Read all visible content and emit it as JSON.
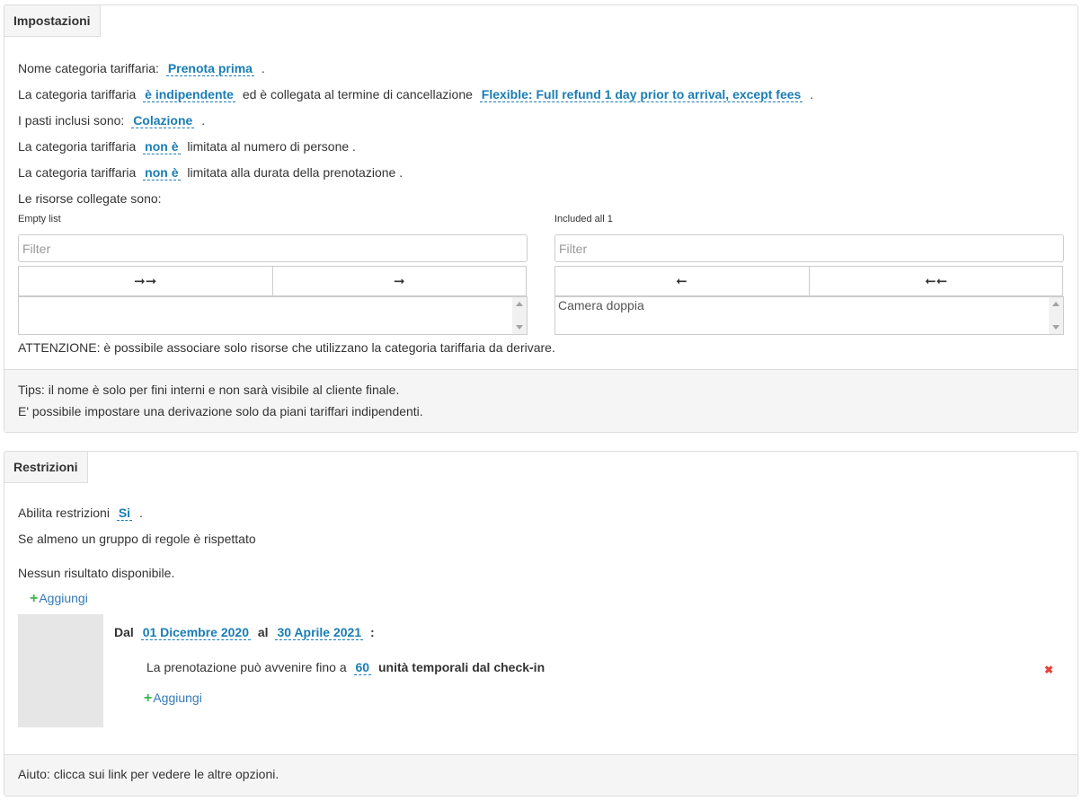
{
  "settings": {
    "tab_label": "Impostazioni",
    "line1": {
      "prefix": "Nome categoria tariffaria:",
      "link": "Prenota prima",
      "suffix": "."
    },
    "line2": {
      "prefix": "La categoria tariffaria",
      "link1": "è indipendente",
      "middle": "ed è collegata al termine di cancellazione",
      "link2": "Flexible: Full refund 1 day prior to arrival, except fees",
      "suffix": "."
    },
    "line3": {
      "prefix": "I pasti inclusi sono:",
      "link": "Colazione",
      "suffix": "."
    },
    "line4": {
      "prefix": "La categoria tariffaria",
      "link": "non è",
      "suffix": "limitata al numero di persone ."
    },
    "line5": {
      "prefix": "La categoria tariffaria",
      "link": "non è",
      "suffix": "limitata alla durata della prenotazione ."
    },
    "line6": "Le risorse collegate sono:",
    "left_list": {
      "title": "Empty list",
      "filter_placeholder": "Filter",
      "btn_move_all": "🠚🠚",
      "btn_move": "🠚",
      "items": []
    },
    "right_list": {
      "title": "Included all 1",
      "filter_placeholder": "Filter",
      "btn_remove": "🠘",
      "btn_remove_all": "🠘🠘",
      "items": [
        "Camera doppia"
      ]
    },
    "warning": "ATTENZIONE: è possibile associare solo risorse che utilizzano la categoria tariffaria da derivare.",
    "footer_line1": "Tips: il nome è solo per fini interni e non sarà visibile al cliente finale.",
    "footer_line2": "E' possibile impostare una derivazione solo da piani tariffari indipendenti."
  },
  "restrictions": {
    "tab_label": "Restrizioni",
    "enable": {
      "prefix": "Abilita restrizioni",
      "link": "Si",
      "suffix": "."
    },
    "group_rule": "Se almeno un gruppo di regole è rispettato",
    "no_results": "Nessun risultato disponibile.",
    "add_label": "Aggiungi",
    "rule": {
      "dal": "Dal",
      "from_date": "01 Dicembre 2020",
      "al": "al",
      "to_date": "30 Aprile 2021",
      "colon": ":",
      "condition_prefix": "La prenotazione può avvenire fino a",
      "condition_value": "60",
      "condition_suffix": "unità temporali dal check-in",
      "add_label": "Aggiungi",
      "delete_icon": "✖"
    },
    "footer": "Aiuto: clicca sui link per vedere le altre opzioni."
  }
}
